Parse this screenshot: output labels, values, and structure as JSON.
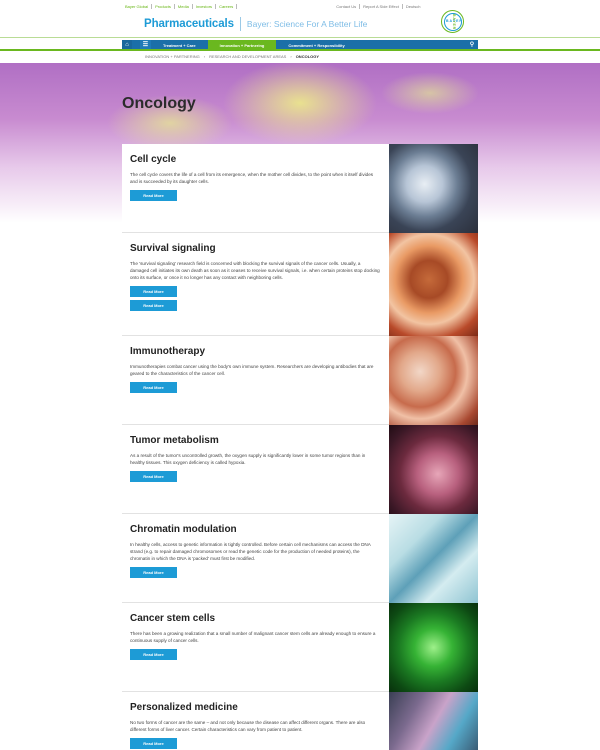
{
  "utility": {
    "items": [
      "Bayer Global",
      "Products",
      "Media",
      "Investors",
      "Careers"
    ],
    "right_items": [
      "Contact Us",
      "Report A Side Effect",
      "Deutsch"
    ]
  },
  "brand": {
    "title": "Pharmaceuticals",
    "tagline": "Bayer: Science For A Better Life",
    "logo_text": "BAYER"
  },
  "nav": {
    "tabs": [
      "Treatment + Care",
      "Innovation + Partnering",
      "Commitment + Responsibility"
    ],
    "active_tab": "Innovation + Partnering",
    "home_icon": "home-icon",
    "menu_icon": "menu-icon",
    "search_icon": "search-icon"
  },
  "breadcrumb": {
    "items": [
      "Innovation + Partnering",
      "Research and Development Areas",
      "Oncology"
    ]
  },
  "page_title": "Oncology",
  "cards": [
    {
      "title": "Cell cycle",
      "text": "The cell cycle covers the life of a cell from its emergence, when the mother cell divides, to the point when it itself divides and is succeeded by its daughter cells.",
      "buttons": [
        "Read More"
      ]
    },
    {
      "title": "Survival signaling",
      "text": "The 'survival signaling' research field is concerned with blocking the survival signals of the cancer cells. Usually, a damaged cell initiates its own death as soon as it ceases to receive survival signals, i.e. when certain proteins stop docking onto its surface, or once it no longer has any contact with neighboring cells.",
      "buttons": [
        "Read More",
        "Read More"
      ]
    },
    {
      "title": "Immunotherapy",
      "text": "Immunotherapies combat cancer using the body's own immune system. Researchers are developing antibodies that are geared to the characteristics of the cancer cell.",
      "buttons": [
        "Read More"
      ]
    },
    {
      "title": "Tumor metabolism",
      "text": "As a result of the tumor's uncontrolled growth, the oxygen supply is significantly lower in some tumor regions than in healthy tissues. This oxygen deficiency is called hypoxia.",
      "buttons": [
        "Read More"
      ]
    },
    {
      "title": "Chromatin modulation",
      "text": "In healthy cells, access to genetic information is tightly controlled. Before certain cell mechanisms can access the DNA strand (e.g. to repair damaged chromosomes or read the genetic code for the production of needed proteins), the chromatin in which the DNA is 'packed' must first be modified.",
      "buttons": [
        "Read More"
      ]
    },
    {
      "title": "Cancer stem cells",
      "text": "There has been a growing realization that a small number of malignant cancer stem cells are already enough to ensure a continuous supply of cancer cells.",
      "buttons": [
        "Read More"
      ]
    },
    {
      "title": "Personalized medicine",
      "text": "No two forms of cancer are the same – and not only because the disease can affect different organs. There are also different forms of liver cancer. Certain characteristics can vary from patient to patient.",
      "buttons": [
        "Read More"
      ]
    }
  ]
}
